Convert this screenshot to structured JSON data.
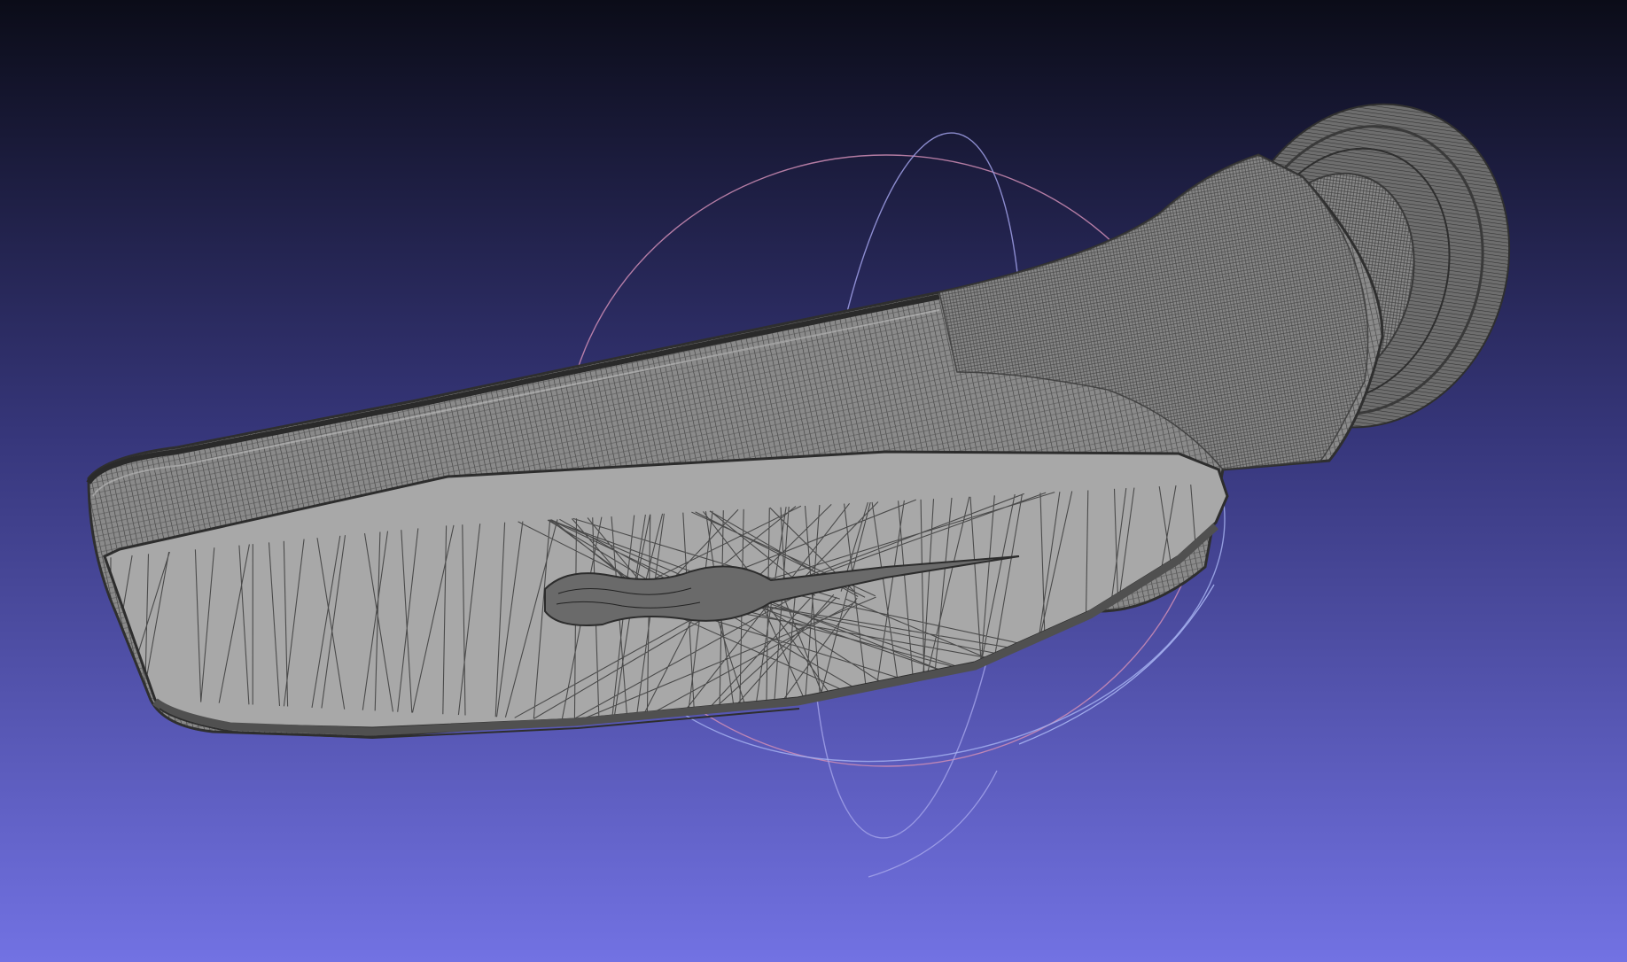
{
  "viewer": {
    "background_top": "#0b0c18",
    "background_bottom": "#7272e3",
    "mesh_fill": "#a7a7a7",
    "wire_color": "#4a4a4a",
    "trackball_colors": [
      "#d08ab0",
      "#9a9ae0",
      "#a0a8f0"
    ]
  },
  "icons": {
    "trackball": "trackball-gizmo-icon",
    "mesh": "wireframe-mesh"
  }
}
